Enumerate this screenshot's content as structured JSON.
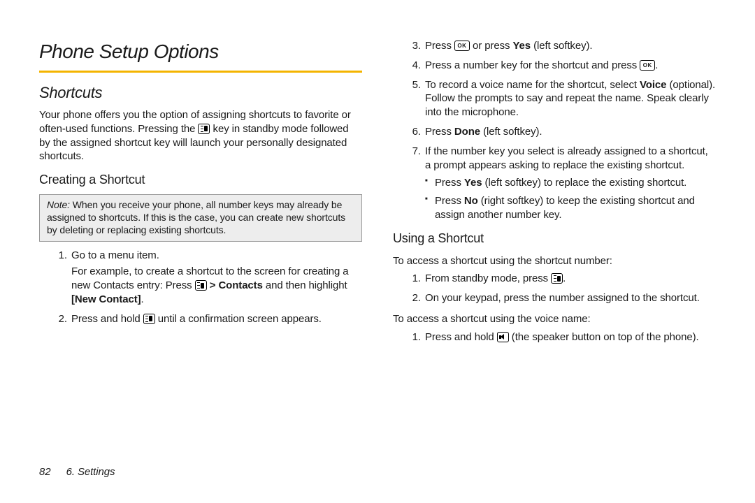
{
  "page_title": "Phone Setup Options",
  "sections": {
    "shortcuts": {
      "heading": "Shortcuts",
      "intro_a": "Your phone offers you the option of assigning shortcuts to favorite or often-used functions. Pressing the ",
      "intro_b": " key in standby mode followed by the assigned shortcut key will launch your personally designated shortcuts."
    },
    "creating": {
      "heading": "Creating a Shortcut",
      "note_label": "Note:",
      "note_body": "When you receive your phone, all number keys may already be assigned to shortcuts. If this is the case, you can create new shortcuts by deleting or replacing existing shortcuts.",
      "steps": {
        "s1_a": "Go to a menu item.",
        "s1_b_a": "For example, to create a shortcut to the screen for creating a new Contacts entry: Press ",
        "s1_b_gt": " > ",
        "s1_b_contacts": "Contacts",
        "s1_b_mid": " and then highlight ",
        "s1_b_new": "[New Contact]",
        "s1_b_end": ".",
        "s2_a": "Press and hold ",
        "s2_b": " until a confirmation screen appears.",
        "s3_a": "Press ",
        "s3_b": " or press ",
        "s3_yes": "Yes",
        "s3_c": " (left softkey).",
        "s4_a": "Press a number key for the shortcut and press ",
        "s4_b": ".",
        "s5_a": "To record a voice name for the shortcut, select ",
        "s5_voice": "Voice",
        "s5_b": " (optional). Follow the prompts to say and repeat the name. Speak clearly into the microphone.",
        "s6_a": "Press ",
        "s6_done": "Done",
        "s6_b": " (left softkey).",
        "s7": "If the number key you select is already assigned to a shortcut, a prompt appears asking to replace the existing shortcut.",
        "s7_sub1_a": "Press ",
        "s7_sub1_yes": "Yes",
        "s7_sub1_b": " (left softkey) to replace the existing shortcut.",
        "s7_sub2_a": "Press ",
        "s7_sub2_no": "No",
        "s7_sub2_b": " (right softkey) to keep the existing shortcut and assign another number key."
      }
    },
    "using": {
      "heading": "Using a Shortcut",
      "lead1": "To access a shortcut using the shortcut number:",
      "list1": {
        "s1_a": "From standby mode, press ",
        "s1_b": ".",
        "s2": "On your keypad, press the number assigned to the shortcut."
      },
      "lead2": "To access a shortcut using the voice name:",
      "list2": {
        "s1_a": "Press and hold ",
        "s1_b": " (the speaker button on top of the phone)."
      }
    }
  },
  "footer": {
    "page_number": "82",
    "chapter": "6. Settings"
  }
}
